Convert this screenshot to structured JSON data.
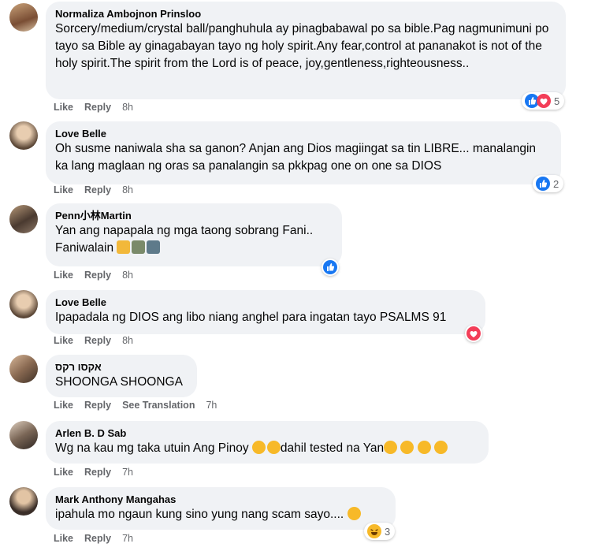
{
  "comments": [
    {
      "name": "Normaliza Ambojnon Prinsloo",
      "text": "Sorcery/medium/crystal ball/panghuhula ay pinagbabawal po sa bible.Pag nagmunimuni po tayo sa Bible ay ginagabayan tayo ng holy spirit.Any fear,control at pananakot is not of the holy spirit.The spirit from the Lord is of peace, joy,gentleness,righteousness..",
      "like": "Like",
      "reply": "Reply",
      "time": "8h",
      "reaction_count": "5",
      "reactions": [
        "like-icon",
        "love-icon"
      ]
    },
    {
      "name": "Love Belle",
      "text": "Oh susme naniwala sha sa ganon? Anjan ang Dios magiingat sa tin LIBRE... manalangin ka lang maglaan ng oras sa panalangin sa pkkpag one on one sa DIOS",
      "like": "Like",
      "reply": "Reply",
      "time": "8h",
      "reaction_count": "2",
      "reactions": [
        "like-icon"
      ]
    },
    {
      "name": "Penn小林Martin",
      "text": "Yan ang napapala ng mga taong sobrang Fani..",
      "text2": "Faniwalain",
      "like": "Like",
      "reply": "Reply",
      "time": "8h",
      "reaction_count": "",
      "reactions": [
        "like-icon"
      ]
    },
    {
      "name": "Love Belle",
      "text": "Ipapadala ng DIOS ang libo niang anghel para ingatan tayo PSALMS 91",
      "like": "Like",
      "reply": "Reply",
      "time": "8h",
      "reaction_count": "",
      "reactions": [
        "love-icon"
      ]
    },
    {
      "name": "אקסו רקס",
      "text": "SHOONGA SHOONGA",
      "like": "Like",
      "reply": "Reply",
      "see_translation": "See Translation",
      "time": "7h"
    },
    {
      "name": "Arlen B. D Sab",
      "text": "Wg na kau mg taka utuin Ang Pinoy",
      "text_mid": "dahil tested na Yan",
      "like": "Like",
      "reply": "Reply",
      "time": "7h"
    },
    {
      "name": "Mark Anthony Mangahas",
      "text": "ipahula mo ngaun kung sino yung nang scam sayo....",
      "like": "Like",
      "reply": "Reply",
      "time": "7h",
      "reaction_count": "3",
      "reactions": [
        "haha-icon"
      ]
    }
  ],
  "colors": {
    "bubble": "#f0f2f5",
    "like_blue": "#1877f2",
    "love_red": "#f33e58",
    "haha_yellow": "#f7b928",
    "meta_gray": "#65676b"
  }
}
